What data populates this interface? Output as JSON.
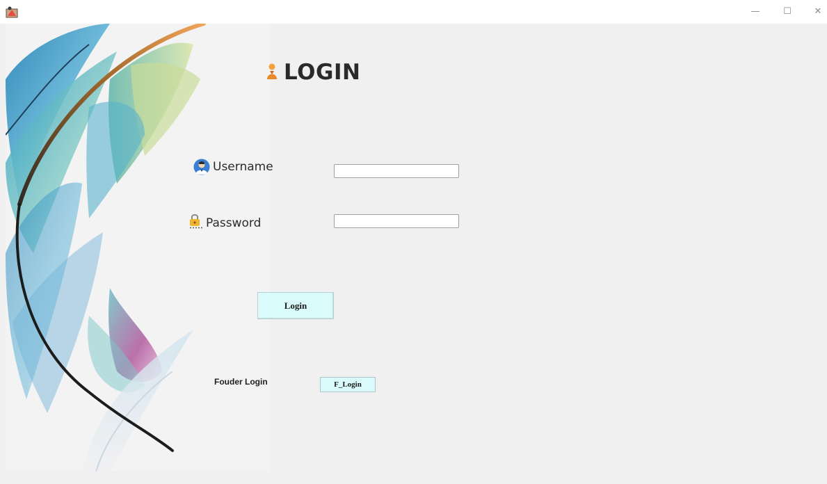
{
  "window": {
    "minimize_glyph": "—",
    "maximize_glyph": "☐",
    "close_glyph": "✕"
  },
  "login": {
    "title": "LOGIN",
    "username_label": "Username",
    "password_label": "Password",
    "username_value": "",
    "password_value": "",
    "login_button": "Login",
    "founder_label": "Fouder Login",
    "founder_button": "F_Login"
  },
  "icons": {
    "app": "java-app-icon",
    "title": "user-figure-icon",
    "username": "user-avatar-icon",
    "password": "lock-icon",
    "decoration": "feather-image"
  },
  "colors": {
    "button_bg": "#d9fbfb",
    "window_bg": "#f0f0f1",
    "title_color": "#2a2a2a"
  }
}
